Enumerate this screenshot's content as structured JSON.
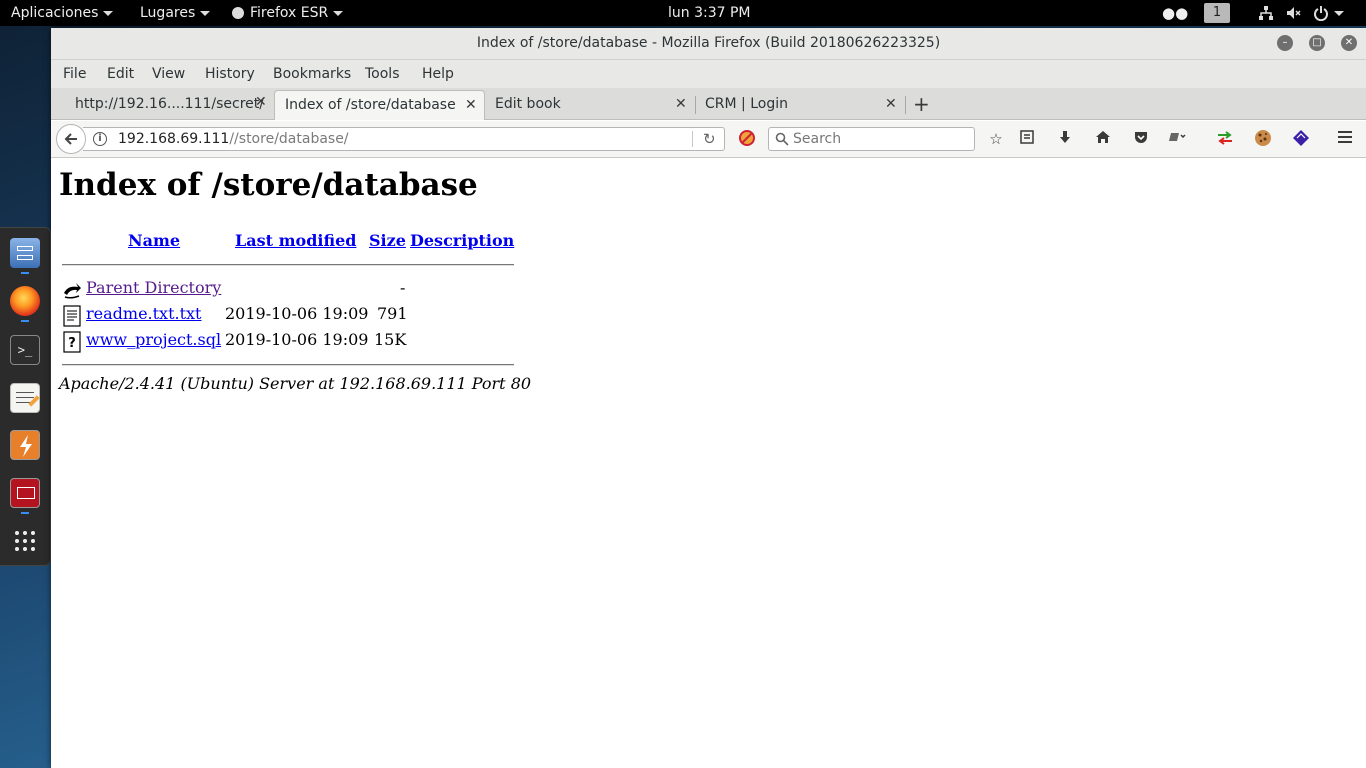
{
  "topbar": {
    "applications": "Aplicaciones",
    "places": "Lugares",
    "app_menu": "Firefox ESR",
    "clock": "lun  3:37 PM",
    "workspace": "1"
  },
  "dock": {
    "items": [
      "file-manager",
      "firefox",
      "terminal",
      "text-editor",
      "burpsuite",
      "metasploit",
      "show-applications"
    ]
  },
  "window": {
    "title": "Index of /store/database - Mozilla Firefox (Build 20180626223325)"
  },
  "menubar": [
    "File",
    "Edit",
    "View",
    "History",
    "Bookmarks",
    "Tools",
    "Help"
  ],
  "tabs": [
    {
      "label": "http://192.16....111/secret/",
      "active": false
    },
    {
      "label": "Index of /store/database",
      "active": true
    },
    {
      "label": "Edit book",
      "active": false
    },
    {
      "label": "CRM | Login",
      "active": false
    }
  ],
  "navbar": {
    "url_host": "192.168.69.111",
    "url_path": "//store/database/",
    "search_placeholder": "Search"
  },
  "page": {
    "title": "Index of /store/database",
    "columns": [
      "Name",
      "Last modified",
      "Size",
      "Description"
    ],
    "rows": [
      {
        "icon": "back-icon",
        "name": "Parent Directory",
        "modified": "",
        "size": "-",
        "visited": true
      },
      {
        "icon": "text-file-icon",
        "name": "readme.txt.txt",
        "modified": "2019-10-06 19:09",
        "size": "791",
        "visited": false
      },
      {
        "icon": "unknown-file-icon",
        "name": "www_project.sql",
        "modified": "2019-10-06 19:09",
        "size": "15K",
        "visited": false
      }
    ],
    "address": "Apache/2.4.41 (Ubuntu) Server at 192.168.69.111 Port 80"
  },
  "colors": {
    "link": "#0000ee",
    "visited": "#551a8b",
    "topbar": "#000000",
    "dock_indicator": "#3b8cf0"
  }
}
